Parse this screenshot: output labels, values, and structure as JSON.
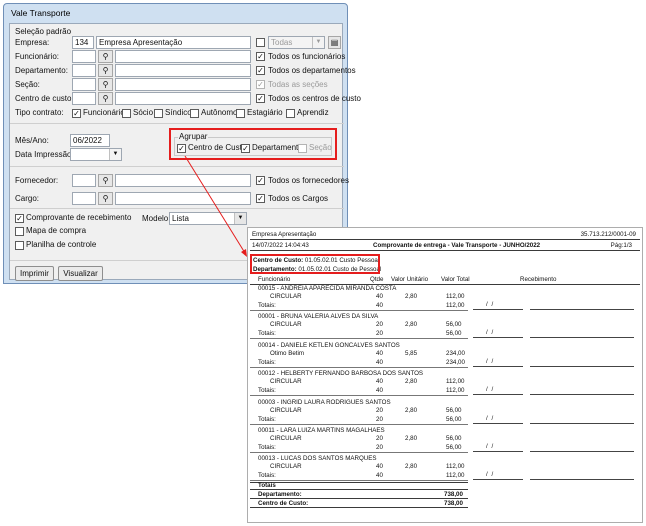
{
  "window": {
    "title": "Vale Transporte"
  },
  "form": {
    "section": "Seleção padrão",
    "empresa": {
      "label": "Empresa:",
      "code": "134",
      "name": "Empresa Apresentação",
      "todas_label": "Todas"
    },
    "funcionario": {
      "label": "Funcionário:",
      "check_label": "Todos os funcionários"
    },
    "departamento": {
      "label": "Departamento:",
      "check_label": "Todos os departamentos"
    },
    "secao": {
      "label": "Seção:",
      "check_label": "Todas as seções"
    },
    "centro_custo": {
      "label": "Centro de custo:",
      "check_label": "Todos os centros de custo"
    },
    "tipo_contrato": {
      "label": "Tipo contrato:",
      "options": [
        "Funcionário",
        "Sócio",
        "Síndico",
        "Autônomo",
        "Estagiário",
        "Aprendiz"
      ]
    },
    "mes_ano": {
      "label": "Mês/Ano:",
      "value": "06/2022"
    },
    "data_impressao": {
      "label": "Data Impressão:"
    },
    "agrupar": {
      "title": "Agrupar",
      "centro": "Centro de Custos",
      "departamento": "Departamento",
      "secao": "Seção"
    },
    "fornecedor": {
      "label": "Fornecedor:",
      "check_label": "Todos os fornecedores"
    },
    "cargo": {
      "label": "Cargo:",
      "check_label": "Todos os Cargos"
    },
    "comprovante": "Comprovante de recebimento",
    "mapa": "Mapa de compra",
    "planilha": "Planilha de controle",
    "modelo": {
      "label": "Modelo:",
      "value": "Lista"
    },
    "imprimir": "Imprimir",
    "visualizar": "Visualizar"
  },
  "report": {
    "company": "Empresa Apresentação",
    "cnpj": "35.713.212/0001-09",
    "datetime": "14/07/2022 14:04:43",
    "title": "Comprovante de entrega - Vale Transporte - JUNHO/2022",
    "page": "Pág:1/3",
    "centro_label": "Centro de Custo:",
    "centro_value": "01.05.02.01 Custo Pessoal",
    "dept_label": "Departamento:",
    "dept_value": "01.05.02.01 Custo de Pessoal",
    "cols": {
      "funcionario": "Funcionário",
      "qtde": "Qtde",
      "unit": "Valor Unitário",
      "total": "Valor Total",
      "receb": "Recebimento"
    },
    "employees": [
      {
        "name": "00015 - ANDREIA APARECIDA MIRANDA COSTA",
        "line": "CIRCULAR",
        "qtde": "40",
        "unit": "2,80",
        "total": "112,00",
        "tot_qtde": "40",
        "tot_val": "112,00"
      },
      {
        "name": "00001 - BRUNA VALERIA ALVES DA SILVA",
        "line": "CIRCULAR",
        "qtde": "20",
        "unit": "2,80",
        "total": "56,00",
        "tot_qtde": "20",
        "tot_val": "56,00"
      },
      {
        "name": "00014 - DANIELE KETLEN GONCALVES SANTOS",
        "line": "Otimo Betim",
        "qtde": "40",
        "unit": "5,85",
        "total": "234,00",
        "tot_qtde": "40",
        "tot_val": "234,00"
      },
      {
        "name": "00012 - HELBERTY FERNANDO BARBOSA DOS SANTOS",
        "line": "CIRCULAR",
        "qtde": "40",
        "unit": "2,80",
        "total": "112,00",
        "tot_qtde": "40",
        "tot_val": "112,00"
      },
      {
        "name": "00003 - INGRID LAURA RODRIGUES SANTOS",
        "line": "CIRCULAR",
        "qtde": "20",
        "unit": "2,80",
        "total": "56,00",
        "tot_qtde": "20",
        "tot_val": "56,00"
      },
      {
        "name": "00011 - LARA LUIZA MARTINS MAGALHAES",
        "line": "CIRCULAR",
        "qtde": "20",
        "unit": "2,80",
        "total": "56,00",
        "tot_qtde": "20",
        "tot_val": "56,00"
      },
      {
        "name": "00013 - LUCAS DOS SANTOS MARQUES",
        "line": "CIRCULAR",
        "qtde": "40",
        "unit": "2,80",
        "total": "112,00",
        "tot_qtde": "40",
        "tot_val": "112,00"
      }
    ],
    "totais_label": "Totais:",
    "totais_header": "Totais",
    "date_mark": "/      /",
    "total_dept_label": "Departamento:",
    "total_dept_value": "738,00",
    "total_cc_label": "Centro de Custo:",
    "total_cc_value": "738,00"
  },
  "colors": {
    "highlight": "#e51d1d",
    "window_frame": "#cfe0f1"
  }
}
